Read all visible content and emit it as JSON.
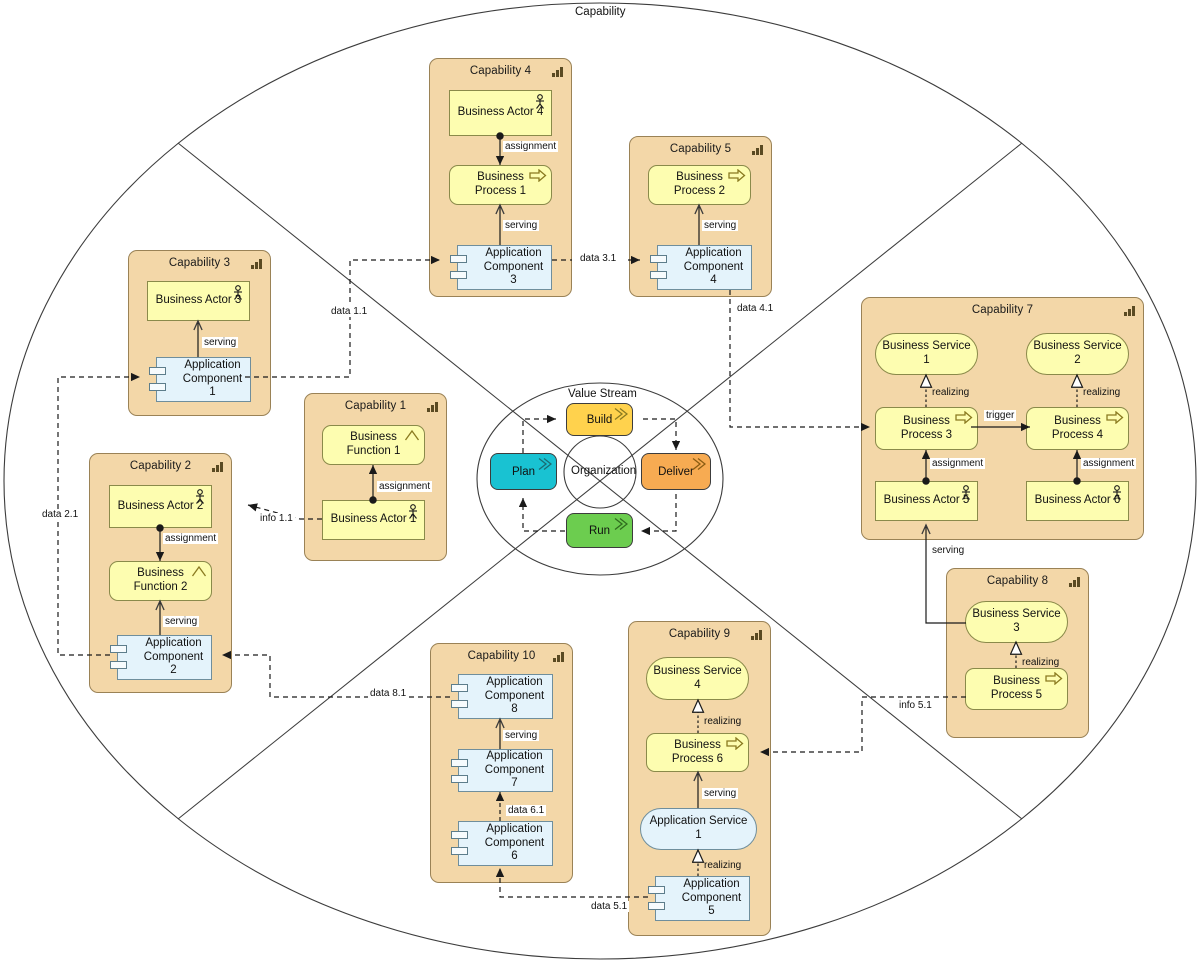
{
  "diagram": {
    "title": "Capability",
    "value_stream_title": "Value Stream",
    "organization_label": "Organization"
  },
  "colors": {
    "capability_fill": "#f3d7a8",
    "capability_stroke": "#9a8256",
    "business_fill": "#fdfdb0",
    "business_stroke": "#8a8a4a",
    "application_fill": "#e4f3fb",
    "application_stroke": "#6f8e9c",
    "plan": "#19c2d2",
    "build": "#ffd24d",
    "deliver": "#f7ab52",
    "run": "#6ccd4f",
    "line": "#3c3c3c"
  },
  "value_stream": {
    "stages": [
      {
        "id": "plan",
        "label": "Plan",
        "color": "#19c2d2"
      },
      {
        "id": "build",
        "label": "Build",
        "color": "#ffd24d"
      },
      {
        "id": "deliver",
        "label": "Deliver",
        "color": "#f7ab52"
      },
      {
        "id": "run",
        "label": "Run",
        "color": "#6ccd4f"
      }
    ]
  },
  "capabilities": [
    {
      "id": "cap1",
      "title": "Capability 1",
      "nodes": [
        {
          "name": "Business Function 1",
          "type": "business-function"
        },
        {
          "name": "Business Actor 1",
          "type": "business-actor"
        }
      ],
      "relations": [
        {
          "label": "assignment"
        }
      ]
    },
    {
      "id": "cap2",
      "title": "Capability 2",
      "nodes": [
        {
          "name": "Business Actor 2",
          "type": "business-actor"
        },
        {
          "name": "Business Function 2",
          "type": "business-function"
        },
        {
          "name": "Application Component 2",
          "type": "application-component"
        }
      ],
      "relations": [
        {
          "label": "assignment"
        },
        {
          "label": "serving"
        }
      ]
    },
    {
      "id": "cap3",
      "title": "Capability 3",
      "nodes": [
        {
          "name": "Business Actor 3",
          "type": "business-actor"
        },
        {
          "name": "Application Component 1",
          "type": "application-component"
        }
      ],
      "relations": [
        {
          "label": "serving"
        }
      ]
    },
    {
      "id": "cap4",
      "title": "Capability 4",
      "nodes": [
        {
          "name": "Business Actor 4",
          "type": "business-actor"
        },
        {
          "name": "Business Process 1",
          "type": "business-process"
        },
        {
          "name": "Application Component 3",
          "type": "application-component"
        }
      ],
      "relations": [
        {
          "label": "assignment"
        },
        {
          "label": "serving"
        }
      ]
    },
    {
      "id": "cap5",
      "title": "Capability 5",
      "nodes": [
        {
          "name": "Business Process 2",
          "type": "business-process"
        },
        {
          "name": "Application Component 4",
          "type": "application-component"
        }
      ],
      "relations": [
        {
          "label": "serving"
        }
      ]
    },
    {
      "id": "cap7",
      "title": "Capability 7",
      "nodes": [
        {
          "name": "Business Service 1",
          "type": "business-service"
        },
        {
          "name": "Business Service 2",
          "type": "business-service"
        },
        {
          "name": "Business Process 3",
          "type": "business-process"
        },
        {
          "name": "Business Process 4",
          "type": "business-process"
        },
        {
          "name": "Business Actor 5",
          "type": "business-actor"
        },
        {
          "name": "Business Actor 6",
          "type": "business-actor"
        }
      ],
      "relations": [
        {
          "label": "realizing"
        },
        {
          "label": "realizing"
        },
        {
          "label": "trigger"
        },
        {
          "label": "assignment"
        },
        {
          "label": "assignment"
        }
      ]
    },
    {
      "id": "cap8",
      "title": "Capability 8",
      "nodes": [
        {
          "name": "Business Service 3",
          "type": "business-service"
        },
        {
          "name": "Business Process 5",
          "type": "business-process"
        }
      ],
      "relations": [
        {
          "label": "realizing"
        }
      ]
    },
    {
      "id": "cap9",
      "title": "Capability 9",
      "nodes": [
        {
          "name": "Business Service 4",
          "type": "business-service"
        },
        {
          "name": "Business Process 6",
          "type": "business-process"
        },
        {
          "name": "Application Service 1",
          "type": "application-service"
        },
        {
          "name": "Application Component 5",
          "type": "application-component"
        }
      ],
      "relations": [
        {
          "label": "realizing"
        },
        {
          "label": "serving"
        },
        {
          "label": "realizing"
        }
      ]
    },
    {
      "id": "cap10",
      "title": "Capability 10",
      "nodes": [
        {
          "name": "Application Component 8",
          "type": "application-component"
        },
        {
          "name": "Application Component 7",
          "type": "application-component"
        },
        {
          "name": "Application Component 6",
          "type": "application-component"
        }
      ],
      "relations": [
        {
          "label": "serving"
        },
        {
          "label": "data 6.1"
        }
      ]
    }
  ],
  "flows": [
    {
      "id": "data11",
      "label": "data 1.1"
    },
    {
      "id": "data21",
      "label": "data 2.1"
    },
    {
      "id": "data31",
      "label": "data 3.1"
    },
    {
      "id": "data41",
      "label": "data 4.1"
    },
    {
      "id": "data51",
      "label": "data 5.1"
    },
    {
      "id": "data61",
      "label": "data 6.1"
    },
    {
      "id": "data81",
      "label": "data 8.1"
    },
    {
      "id": "info11",
      "label": "info 1.1"
    },
    {
      "id": "info51",
      "label": "info 5.1"
    }
  ],
  "labels": {
    "assignment": "assignment",
    "serving": "serving",
    "realizing": "realizing",
    "trigger": "trigger"
  },
  "nodes": {
    "ba1": "Business Actor 1",
    "ba2": "Business Actor 2",
    "ba3": "Business Actor 3",
    "ba4": "Business Actor 4",
    "ba5": "Business Actor 5",
    "ba6": "Business Actor 6",
    "bf1": "Business Function 1",
    "bf2": "Business Function 2",
    "bp1": "Business Process 1",
    "bp2": "Business Process 2",
    "bp3": "Business Process 3",
    "bp4": "Business Process 4",
    "bp5": "Business Process 5",
    "bp6": "Business Process 6",
    "bs1": "Business Service 1",
    "bs2": "Business Service 2",
    "bs3": "Business Service 3",
    "bs4": "Business Service 4",
    "as1": "Application Service 1",
    "ac1": "Application Component 1",
    "ac2": "Application Component 2",
    "ac3": "Application Component 3",
    "ac4": "Application Component 4",
    "ac5": "Application Component 5",
    "ac6": "Application Component 6",
    "ac7": "Application Component 7",
    "ac8": "Application Component 8"
  },
  "capability_titles": {
    "c1": "Capability 1",
    "c2": "Capability 2",
    "c3": "Capability 3",
    "c4": "Capability 4",
    "c5": "Capability 5",
    "c7": "Capability 7",
    "c8": "Capability 8",
    "c9": "Capability 9",
    "c10": "Capability 10"
  }
}
